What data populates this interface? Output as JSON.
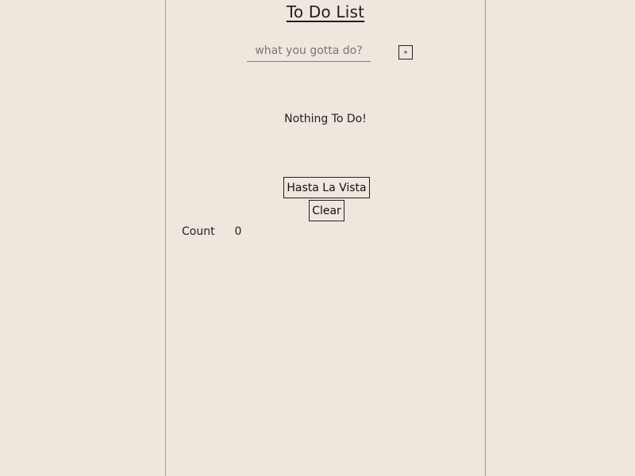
{
  "header": {
    "title": "To Do List"
  },
  "form": {
    "placeholder": "what you gotta do?",
    "add_label": "+"
  },
  "list": {
    "empty_message": "Nothing To Do!"
  },
  "actions": {
    "primary_label": "Hasta La Vista",
    "clear_label": "Clear"
  },
  "stats": {
    "count_label": "Count",
    "count_value": "0"
  }
}
